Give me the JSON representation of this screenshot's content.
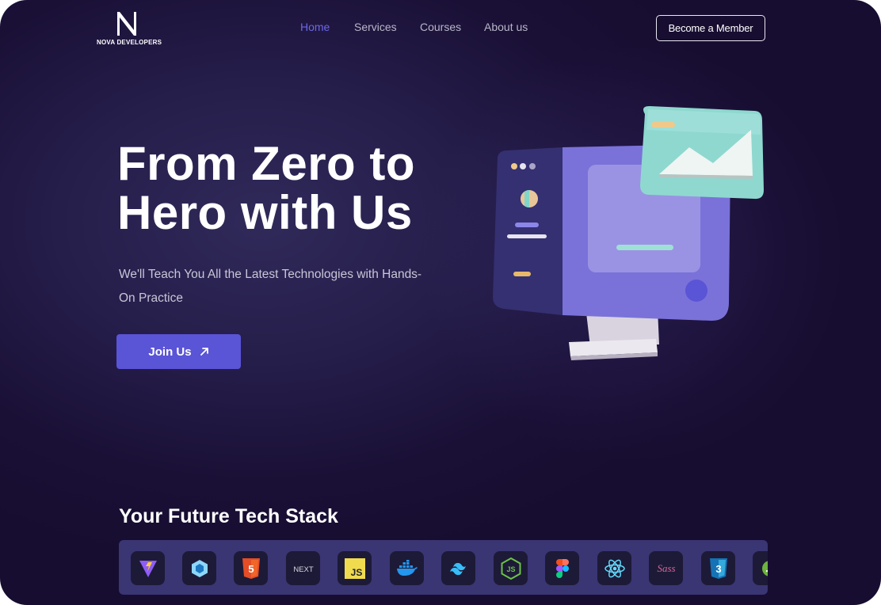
{
  "brand": {
    "logo_letter": "N",
    "name": "NOVA DEVELOPERS"
  },
  "nav": {
    "items": [
      {
        "label": "Home",
        "active": true
      },
      {
        "label": "Services",
        "active": false
      },
      {
        "label": "Courses",
        "active": false
      },
      {
        "label": "About us",
        "active": false
      }
    ]
  },
  "header": {
    "cta_label": "Become a Member"
  },
  "hero": {
    "title_line1": "From Zero to",
    "title_line2": "Hero with Us",
    "subtitle": "We'll Teach You All the Latest Technologies with Hands-On Practice",
    "join_label": "Join Us",
    "illustration": "computer-monitor-3d"
  },
  "stack": {
    "title": "Your Future Tech Stack",
    "icons": [
      {
        "name": "vite-icon",
        "label": ""
      },
      {
        "name": "webpack-icon",
        "label": ""
      },
      {
        "name": "html5-icon",
        "label": "5"
      },
      {
        "name": "nextjs-icon",
        "label": "NEXT"
      },
      {
        "name": "javascript-icon",
        "label": "JS"
      },
      {
        "name": "docker-icon",
        "label": ""
      },
      {
        "name": "tailwind-icon",
        "label": ""
      },
      {
        "name": "nodejs-icon",
        "label": "JS"
      },
      {
        "name": "figma-icon",
        "label": ""
      },
      {
        "name": "react-icon",
        "label": ""
      },
      {
        "name": "sass-icon",
        "label": "Sass"
      },
      {
        "name": "css3-icon",
        "label": "3"
      },
      {
        "name": "spring-icon",
        "label": ""
      }
    ]
  },
  "colors": {
    "background": "#1a1036",
    "accent": "#5a54d6",
    "nav_active": "#6b67e8",
    "stack_bar": "#3a3573"
  }
}
